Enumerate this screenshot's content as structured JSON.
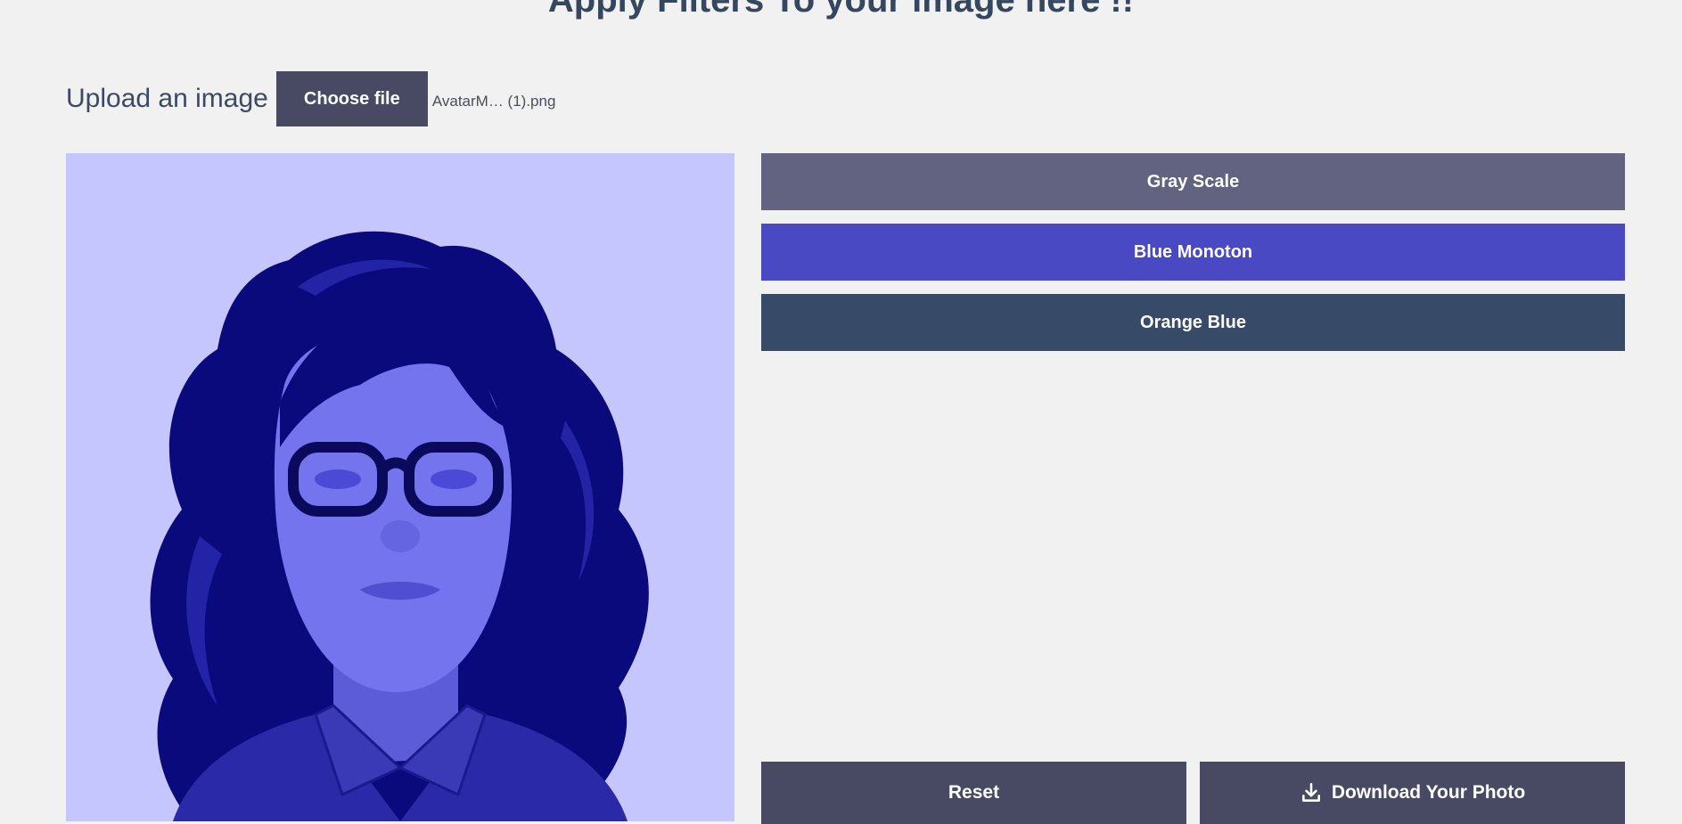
{
  "header": {
    "title": "Apply Filters To your image here !!"
  },
  "upload": {
    "label": "Upload an image",
    "button_label": "Choose file",
    "file_name": "AvatarM… (1).png"
  },
  "filters": [
    {
      "label": "Gray Scale",
      "color": "#626281"
    },
    {
      "label": "Blue Monoton",
      "color": "#4849c3"
    },
    {
      "label": "Orange Blue",
      "color": "#374a68"
    }
  ],
  "actions": {
    "reset_label": "Reset",
    "download_label": "Download Your Photo",
    "download_icon": "download-icon"
  },
  "preview": {
    "background_color": "#c6c6fe",
    "hair_color": "#0b0a7c",
    "skin_color": "#7474ee",
    "shirt_color": "#2a2aa8"
  }
}
